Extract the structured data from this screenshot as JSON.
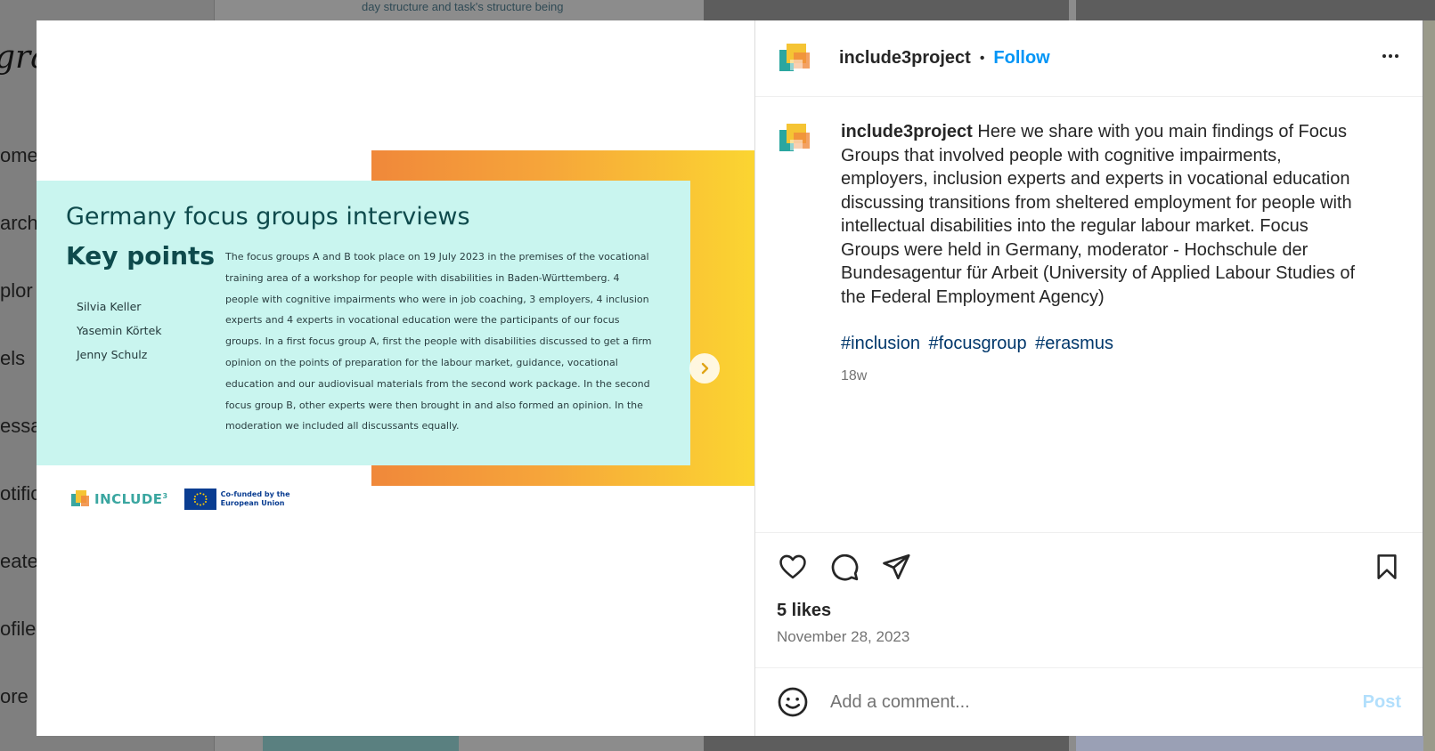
{
  "background": {
    "logo_text": "gra",
    "nav_items": [
      "ome",
      "arch",
      "plor",
      "els",
      "essa",
      "otific",
      "eate",
      "ofile",
      "ore"
    ],
    "snippet_text": "day structure and task's structure being"
  },
  "slide": {
    "title": "Germany focus groups interviews",
    "subtitle": "Key points",
    "names": [
      "Silvia Keller",
      "Yasemin Körtek",
      "Jenny Schulz"
    ],
    "body": "The focus groups A and B took place on 19 July 2023 in the premises of the vocational training area of a workshop for people with disabilities in Baden-Württemberg. 4 people with cognitive impairments who were in job coaching, 3 employers, 4 inclusion experts and 4 experts in vocational education were the participants of our focus groups. In a first focus group A, first the people with disabilities discussed to get a firm opinion on the points of preparation for the labour market, guidance, vocational education and our audiovisual materials from the second work package. In the second focus group B, other experts were then brought in and also formed an opinion. In the moderation we included all discussants equally.",
    "include_logo_text": "INCLUDE",
    "include_logo_sup": "3",
    "eu_text": "Co-funded by the European Union",
    "next_icon": "chevron-right-icon"
  },
  "post": {
    "username": "include3project",
    "dot": "•",
    "follow_label": "Follow",
    "more_icon": "more-horizontal-icon",
    "caption_username": "include3project",
    "caption_text": "Here we share with you main findings of Focus Groups that involved people with cognitive impairments, employers, inclusion experts and experts in vocational education discussing transitions from sheltered employment for people with intellectual disabilities into the regular labour market. Focus Groups were held in Germany, moderator - Hochschule der Bundesagentur für Arbeit (University of Applied Labour Studies of the Federal Employment Agency)",
    "hashtags": [
      "#inclusion",
      "#focusgroup",
      "#erasmus"
    ],
    "age": "18w",
    "likes": "5 likes",
    "date": "November 28, 2023",
    "comment_placeholder": "Add a comment...",
    "post_label": "Post"
  },
  "colors": {
    "follow": "#0095f6",
    "hashtag": "#00376b",
    "teal_box": "#c9f5ef",
    "gradient_start": "#f0883a",
    "gradient_end": "#fbd531"
  }
}
